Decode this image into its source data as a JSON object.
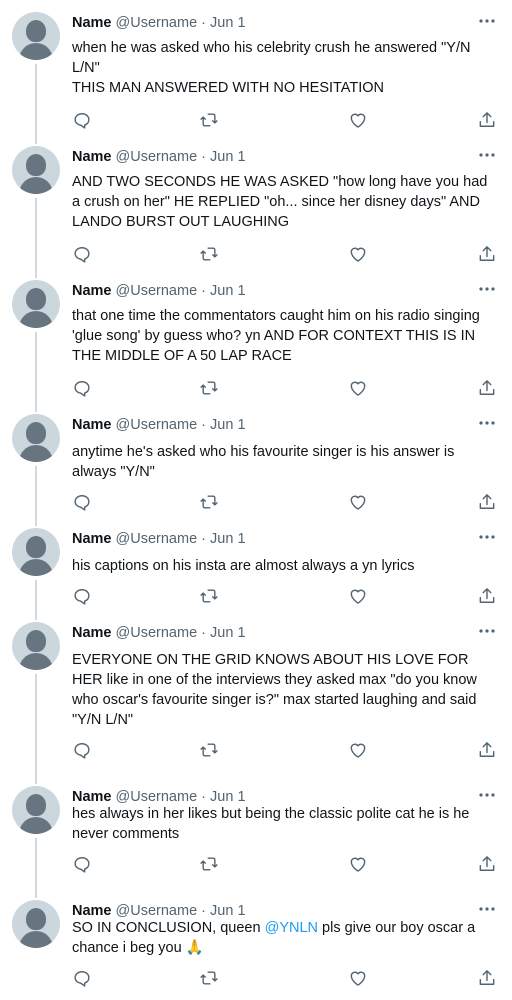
{
  "tweets": [
    {
      "name": "Name",
      "handle": "@Username",
      "sep": " · ",
      "date": "Jun 1",
      "text": "when he was asked who his celebrity crush he answered \"Y/N L/N\"\nTHIS MAN ANSWERED WITH NO HESITATION"
    },
    {
      "name": "Name",
      "handle": "@Username",
      "sep": " · ",
      "date": "Jun 1",
      "text": "AND TWO SECONDS HE WAS ASKED \"how long have you had a crush on her\" HE REPLIED \"oh... since her disney days\" AND LANDO BURST OUT LAUGHING"
    },
    {
      "name": "Name",
      "handle": "@Username",
      "sep": " · ",
      "date": "Jun 1",
      "text": "that one time the commentators caught him on his radio singing 'glue song' by guess who? yn AND FOR CONTEXT THIS IS IN THE MIDDLE OF A 50 LAP RACE"
    },
    {
      "name": "Name",
      "handle": "@Username",
      "sep": " · ",
      "date": "Jun 1",
      "text": "anytime he's asked who his favourite singer is his answer is always \"Y/N\""
    },
    {
      "name": "Name",
      "handle": "@Username",
      "sep": " · ",
      "date": "Jun 1",
      "text": "his captions on his insta are almost always a yn lyrics"
    },
    {
      "name": "Name",
      "handle": "@Username",
      "sep": " · ",
      "date": "Jun 1",
      "text": "EVERYONE ON THE GRID KNOWS ABOUT HIS LOVE FOR HER like in one of the interviews they asked max \"do you know who oscar's favourite singer is?\" max started laughing and said \"Y/N L/N\""
    },
    {
      "name": "Name",
      "handle": "@Username",
      "sep": " · ",
      "date": "Jun 1",
      "text": "hes always in her likes but being the classic polite cat he is he never comments"
    },
    {
      "name": "Name",
      "handle": "@Username",
      "sep": " · ",
      "date": "Jun 1",
      "text_before": "SO IN CONCLUSION, queen ",
      "mention": "@YNLN",
      "text_after": " pls give our boy oscar a chance i beg you ",
      "emoji": "🙏"
    }
  ],
  "icons": {
    "reply": "reply-icon",
    "retweet": "retweet-icon",
    "like": "heart-icon",
    "share": "share-icon",
    "more": "more-icon"
  },
  "colors": {
    "text": "#0f1419",
    "muted": "#536471",
    "link": "#1d9bf0",
    "thread_line": "#cfd9de",
    "avatar_bg": "#ccd6dd",
    "avatar_fg": "#66757f"
  }
}
